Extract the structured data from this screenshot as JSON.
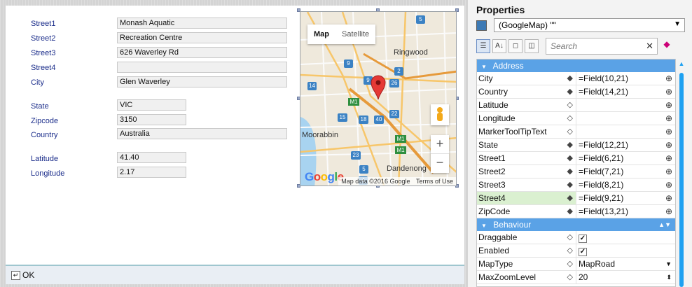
{
  "form": {
    "fields": [
      {
        "label": "Street1",
        "value": "Monash Aquatic"
      },
      {
        "label": "Street2",
        "value": "Recreation Centre"
      },
      {
        "label": "Street3",
        "value": "626 Waverley Rd"
      },
      {
        "label": "Street4",
        "value": ""
      },
      {
        "label": "City",
        "value": "Glen Waverley"
      },
      {
        "label": "State",
        "value": "VIC"
      },
      {
        "label": "Zipcode",
        "value": "3150"
      },
      {
        "label": "Country",
        "value": "Australia"
      },
      {
        "label": "Latitude",
        "value": "41.40"
      },
      {
        "label": "Longitude",
        "value": "2.17"
      }
    ],
    "ok_label": "OK"
  },
  "map": {
    "type_buttons": [
      "Map",
      "Satellite"
    ],
    "zoom_in": "+",
    "zoom_out": "−",
    "logo": "Google",
    "attribution": "Map data ©2016 Google",
    "terms": "Terms of Use",
    "place_labels": [
      "Ringwood",
      "Moorabbin",
      "Dandenong"
    ],
    "road_shields": [
      "5",
      "9",
      "9",
      "14",
      "26",
      "2",
      "M1",
      "22",
      "15",
      "18",
      "40",
      "M1",
      "M1",
      "23",
      "5",
      "4"
    ]
  },
  "properties": {
    "title": "Properties",
    "object": "(GoogleMap) \"\"",
    "search_placeholder": "Search",
    "categories": [
      {
        "name": "Address",
        "rows": [
          {
            "name": "City",
            "value": "=Field(10,21)",
            "set": true
          },
          {
            "name": "Country",
            "value": "=Field(14,21)",
            "set": true
          },
          {
            "name": "Latitude",
            "value": "",
            "set": false
          },
          {
            "name": "Longitude",
            "value": "",
            "set": false
          },
          {
            "name": "MarkerToolTipText",
            "value": "",
            "set": false
          },
          {
            "name": "State",
            "value": "=Field(12,21)",
            "set": true
          },
          {
            "name": "Street1",
            "value": "=Field(6,21)",
            "set": true
          },
          {
            "name": "Street2",
            "value": "=Field(7,21)",
            "set": true
          },
          {
            "name": "Street3",
            "value": "=Field(8,21)",
            "set": true
          },
          {
            "name": "Street4",
            "value": "=Field(9,21)",
            "set": true,
            "selected": true
          },
          {
            "name": "ZipCode",
            "value": "=Field(13,21)",
            "set": true
          }
        ]
      },
      {
        "name": "Behaviour",
        "rows": [
          {
            "name": "Draggable",
            "value": "",
            "checked": true
          },
          {
            "name": "Enabled",
            "value": "",
            "checked": true
          },
          {
            "name": "MapType",
            "value": "MapRoad",
            "dropdown": true
          },
          {
            "name": "MaxZoomLevel",
            "value": "20",
            "spinner": true
          }
        ]
      }
    ]
  }
}
